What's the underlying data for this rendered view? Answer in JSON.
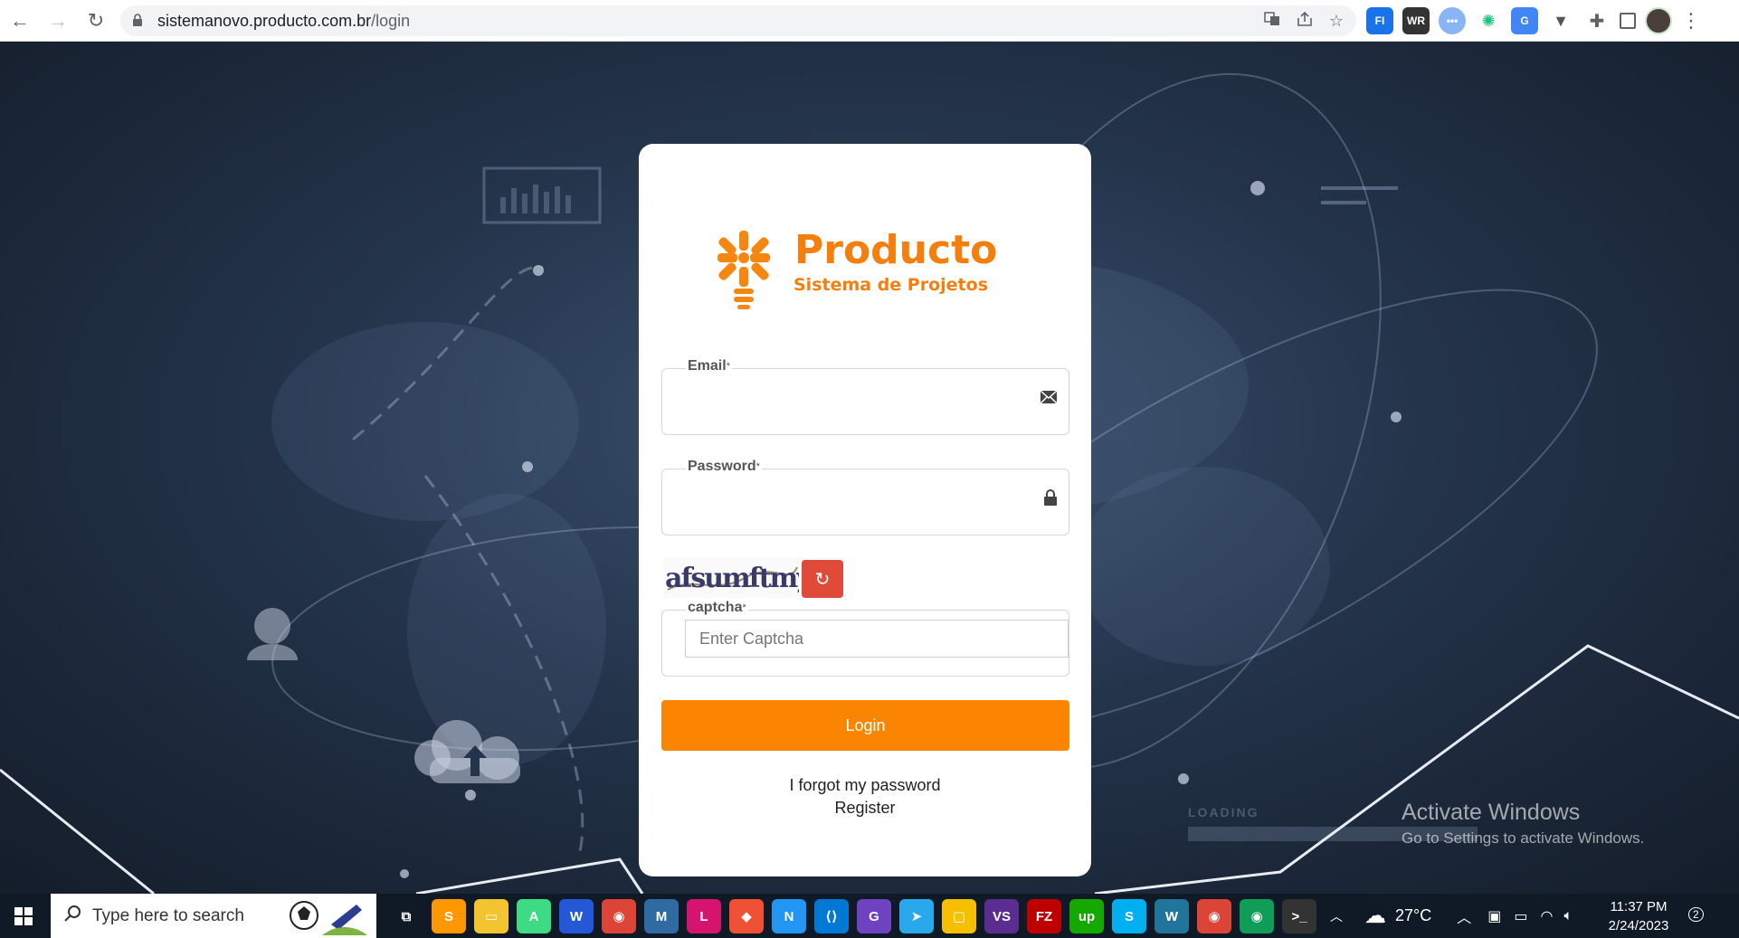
{
  "browser": {
    "url_host": "sistemanovo.producto.com.br",
    "url_path": "/login",
    "extensions": [
      {
        "name": "google-translate-icon",
        "label": "",
        "color": "#5f6368"
      },
      {
        "name": "fi-extension-icon",
        "label": "FI",
        "color": "#1a73e8"
      },
      {
        "name": "wr-extension-icon",
        "label": "WR",
        "color": "#333333"
      },
      {
        "name": "dots-extension-icon",
        "label": "",
        "color": "#8ab4f8"
      },
      {
        "name": "openai-extension-icon",
        "label": "",
        "color": "#19c37d"
      },
      {
        "name": "translate-extension-icon",
        "label": "",
        "color": "#4285f4"
      },
      {
        "name": "vue-extension-icon",
        "label": "V",
        "color": "#555555"
      }
    ]
  },
  "login": {
    "brand_title": "Producto",
    "brand_subtitle": "Sistema de Projetos",
    "email_label": "Email",
    "password_label": "Password",
    "required_mark": "*",
    "captcha_image_text": "afsumftmy",
    "captcha_label": "captcha",
    "captcha_placeholder": "Enter Captcha",
    "refresh_glyph": "↻",
    "login_button": "Login",
    "forgot_password": "I forgot my password",
    "register": "Register"
  },
  "watermark": {
    "title": "Activate Windows",
    "subtitle": "Go to Settings to activate Windows."
  },
  "taskbar": {
    "search_placeholder": "Type here to search",
    "apps": [
      {
        "name": "task-view-icon",
        "label": "⧉",
        "color": "transparent"
      },
      {
        "name": "sublime-text-icon",
        "label": "S",
        "color": "#ff9800"
      },
      {
        "name": "file-explorer-icon",
        "label": "▭",
        "color": "#f4c430"
      },
      {
        "name": "android-studio-icon",
        "label": "A",
        "color": "#3ddc84"
      },
      {
        "name": "wps-icon",
        "label": "W",
        "color": "#2458d6"
      },
      {
        "name": "chrome-icon",
        "label": "◉",
        "color": "#db4437"
      },
      {
        "name": "mysql-workbench-icon",
        "label": "M",
        "color": "#2f6aa3"
      },
      {
        "name": "laragon-icon",
        "label": "L",
        "color": "#d4146f"
      },
      {
        "name": "git-icon",
        "label": "◆",
        "color": "#f05033"
      },
      {
        "name": "network-tool-icon",
        "label": "N",
        "color": "#2196f3"
      },
      {
        "name": "vscode-icon",
        "label": "⟨⟩",
        "color": "#0078d4"
      },
      {
        "name": "github-desktop-icon",
        "label": "G",
        "color": "#6f42c1"
      },
      {
        "name": "telegram-icon",
        "label": "➤",
        "color": "#29a9eb"
      },
      {
        "name": "notes-icon",
        "label": "▢",
        "color": "#f6c000"
      },
      {
        "name": "visual-studio-icon",
        "label": "VS",
        "color": "#5c2d91"
      },
      {
        "name": "filezilla-icon",
        "label": "FZ",
        "color": "#bf0000"
      },
      {
        "name": "upwork-icon",
        "label": "up",
        "color": "#14a800"
      },
      {
        "name": "skype-icon",
        "label": "S",
        "color": "#00aff0"
      },
      {
        "name": "wordpress-icon",
        "label": "W",
        "color": "#21759b"
      },
      {
        "name": "chrome-profile-icon",
        "label": "◉",
        "color": "#db4437"
      },
      {
        "name": "chrome-active-icon",
        "label": "◉",
        "color": "#0f9d58"
      },
      {
        "name": "terminal-icon",
        "label": ">_",
        "color": "#333333"
      }
    ],
    "temperature": "27°C",
    "time": "11:37 PM",
    "date": "2/24/2023",
    "notifications": "2"
  }
}
